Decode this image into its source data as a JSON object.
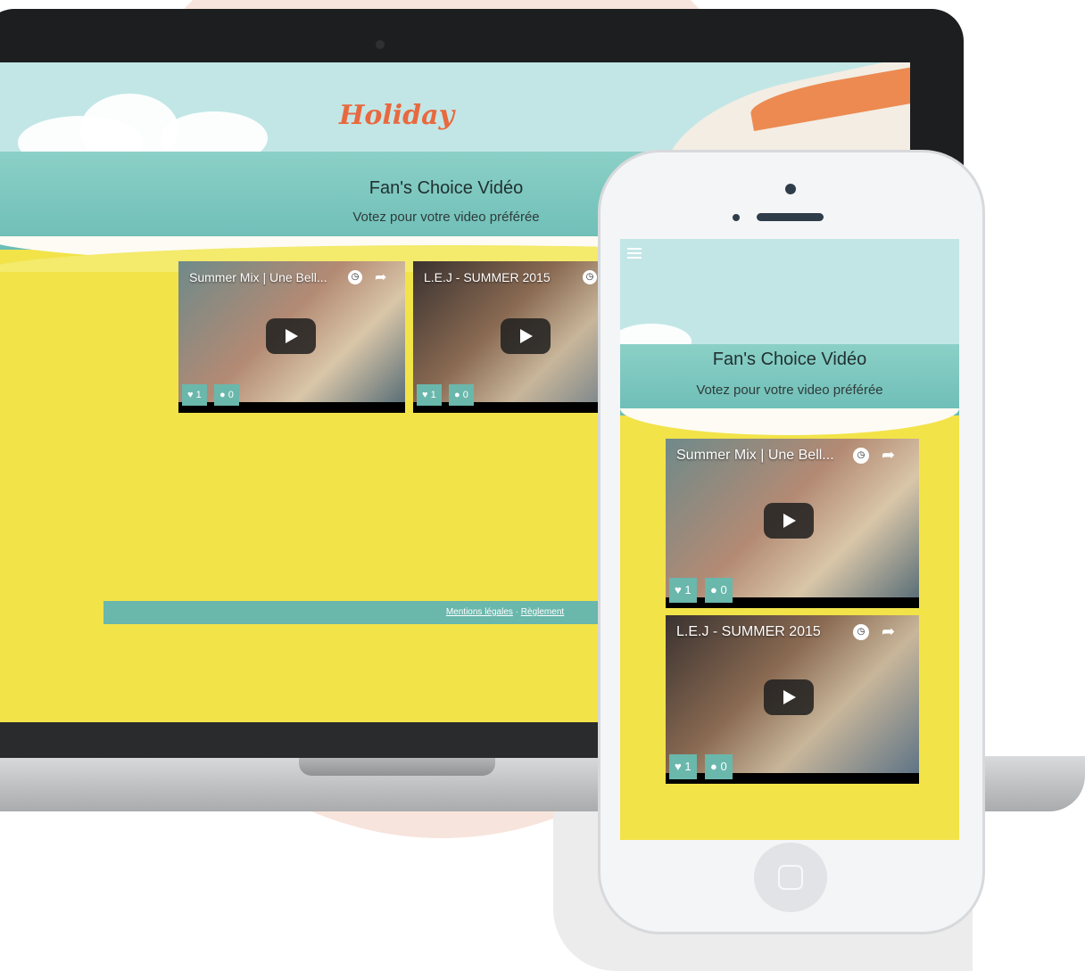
{
  "desktop": {
    "logo": "Holiday",
    "title": "Fan's Choice Vidéo",
    "subtitle": "Votez pour votre video préférée",
    "videos": [
      {
        "title": "Summer Mix | Une Bell...",
        "likes": "1",
        "comments": "0"
      },
      {
        "title": "L.E.J - SUMMER 2015",
        "likes": "1",
        "comments": "0"
      }
    ],
    "footer": {
      "legal": "Mentions légales",
      "separator": "·",
      "rules": "Règlement"
    }
  },
  "mobile": {
    "title": "Fan's Choice Vidéo",
    "subtitle": "Votez pour votre video préférée",
    "videos": [
      {
        "title": "Summer Mix | Une Bell...",
        "likes": "1",
        "comments": "0"
      },
      {
        "title": "L.E.J - SUMMER 2015",
        "likes": "1",
        "comments": "0"
      }
    ]
  },
  "icons": {
    "heart": "♥",
    "comment": "●",
    "clock": "◷",
    "share": "➦"
  },
  "colors": {
    "sand": "#f2e349",
    "sea": "#6cbdb6",
    "sky": "#c2e6e6",
    "badge": "#6ab7ac",
    "logo": "#e8693e"
  }
}
